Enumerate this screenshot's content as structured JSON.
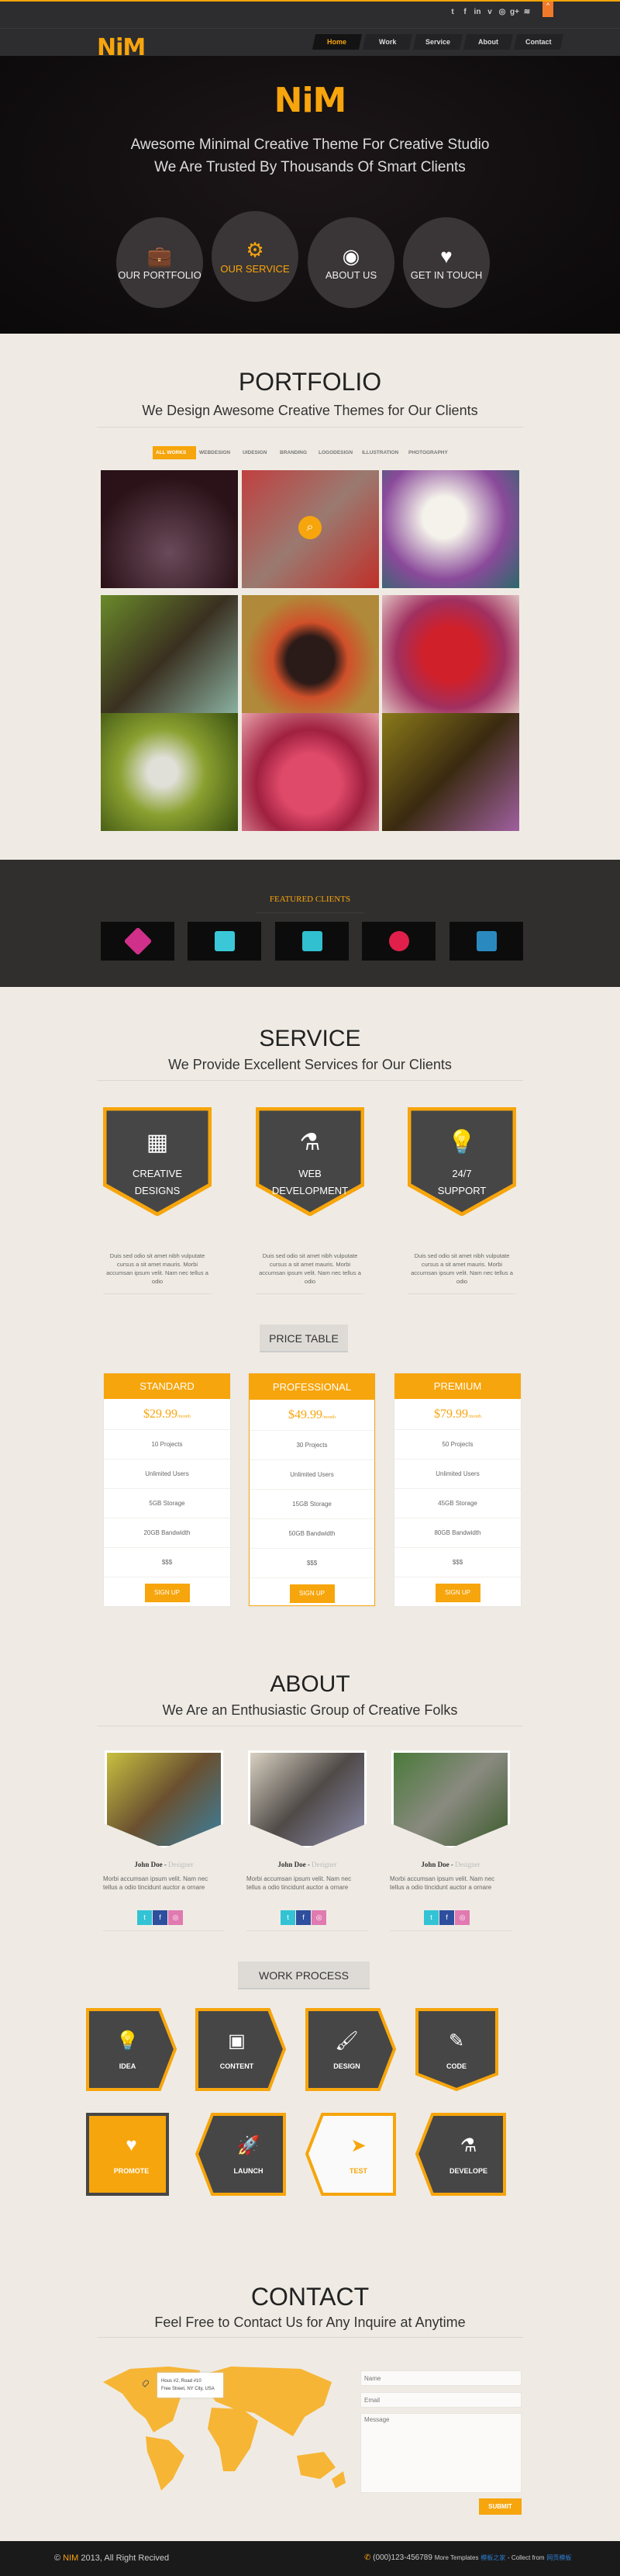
{
  "header": {
    "logo": "NiM",
    "social": [
      "twitter",
      "facebook",
      "linkedin",
      "vimeo",
      "dribbble",
      "google-plus",
      "rss"
    ],
    "social_glyphs": [
      "t",
      "f",
      "in",
      "v",
      "◎",
      "g+",
      "≋"
    ],
    "to_top": "^",
    "nav": [
      "Home",
      "Work",
      "Service",
      "About",
      "Contact"
    ],
    "active_nav": "Home"
  },
  "hero": {
    "logo": "NiM",
    "line1": "Awesome Minimal Creative Theme For Creative Studio",
    "line2": "We Are Trusted By Thousands Of Smart Clients",
    "buttons": [
      {
        "label": "OUR PORTFOLIO",
        "icon": "briefcase-icon",
        "glyph": "💼"
      },
      {
        "label": "OUR SERVICE",
        "icon": "gear-icon",
        "glyph": "⚙"
      },
      {
        "label": "ABOUT US",
        "icon": "eye-icon",
        "glyph": "◉"
      },
      {
        "label": "GET IN TOUCH",
        "icon": "heart-icon",
        "glyph": "♥"
      }
    ]
  },
  "portfolio": {
    "title": "PORTFOLIO",
    "subtitle": "We Design Awesome Creative Themes for Our Clients",
    "filters": [
      "ALL WORKS",
      "WEBDESIGN",
      "UIDESIGN",
      "BRANDING",
      "LOGODESIGN",
      "ILLUSTRATION",
      "PHOTOGRAPHY"
    ],
    "active_filter": "ALL WORKS",
    "items": [
      "sneakers",
      "merry-christmas",
      "orchid",
      "horse",
      "butterfly",
      "strawberries",
      "dandelion",
      "pink-shoes",
      "bicycle"
    ],
    "zoom_icon": "⌕"
  },
  "clients": {
    "title": "FEATURED CLIENTS",
    "logos": [
      "HB",
      "stripes",
      "bars",
      "V",
      "S"
    ]
  },
  "service": {
    "title": "SERVICE",
    "subtitle": "We Provide Excellent Services for Our Clients",
    "items": [
      {
        "line1": "CREATIVE",
        "line2": "DESIGNS",
        "icon": "presentation-icon"
      },
      {
        "line1": "WEB",
        "line2": "DEVELOPMENT",
        "icon": "flask-icon"
      },
      {
        "line1": "24/7",
        "line2": "SUPPORT",
        "icon": "lamp-icon"
      }
    ],
    "desc": "Duis sed odio sit amet nibh vulputate cursus a sit amet mauris. Morbi accumsan ipsum velit. Nam nec tellus a odio"
  },
  "pricing": {
    "button": "PRICE TABLE",
    "plans": [
      {
        "name": "STANDARD",
        "price": "$29.99",
        "per": "/month",
        "features": [
          "10 Projects",
          "Unlimited Users",
          "5GB Storage",
          "20GB Bandwidth",
          "$$$"
        ],
        "cta": "SIGN UP"
      },
      {
        "name": "PROFESSIONAL",
        "price": "$49.99",
        "per": "/month",
        "features": [
          "30 Projects",
          "Unlimited Users",
          "15GB Storage",
          "50GB Bandwidth",
          "$$$"
        ],
        "cta": "SIGN UP"
      },
      {
        "name": "PREMIUM",
        "price": "$79.99",
        "per": "/month",
        "features": [
          "50 Projects",
          "Unlimited Users",
          "45GB Storage",
          "80GB Bandwidth",
          "$$$"
        ],
        "cta": "SIGN UP"
      }
    ]
  },
  "about": {
    "title": "ABOUT",
    "subtitle": "We Are an Enthusiastic Group of Creative Folks",
    "members": [
      {
        "name": "John Doe",
        "role": "Designer",
        "bio": "Morbi accumsan ipsum velit. Nam nec tellus a odio tincidunt auctor a ornare"
      },
      {
        "name": "John Doe",
        "role": "Designer",
        "bio": "Morbi accumsan ipsum velit. Nam nec tellus a odio tincidunt auctor a ornare"
      },
      {
        "name": "John Doe",
        "role": "Designer",
        "bio": "Morbi accumsan ipsum velit. Nam nec tellus a odio tincidunt auctor a ornare"
      }
    ],
    "social_colors": [
      "#33c3d4",
      "#2d4f9e",
      "#e07ab0"
    ]
  },
  "process": {
    "button": "WORK PROCESS",
    "steps": [
      {
        "label": "IDEA",
        "glyph": "💡"
      },
      {
        "label": "CONTENT",
        "glyph": "▣"
      },
      {
        "label": "DESIGN",
        "glyph": "🖌"
      },
      {
        "label": "CODE",
        "glyph": "✎"
      },
      {
        "label": "PROMOTE",
        "glyph": "♥"
      },
      {
        "label": "LAUNCH",
        "glyph": "🚀"
      },
      {
        "label": "TEST",
        "glyph": "➤"
      },
      {
        "label": "DEVELOPE",
        "glyph": "⚗"
      }
    ]
  },
  "contact": {
    "title": "CONTACT",
    "subtitle": "Feel Free to Contact Us for Any Inquire at Anytime",
    "address1": "Hous #2, Road #10",
    "address2": "Free Street, NY City, USA",
    "name_placeholder": "Name",
    "email_placeholder": "Email",
    "message_placeholder": "Message",
    "submit": "SUBMIT"
  },
  "footer": {
    "copy_prefix": "©",
    "brand": "NIM",
    "copy_suffix": "2013, All Right Recived",
    "phone": "(000)123-456789",
    "more": "More Templates",
    "link1": "模板之家",
    "collect": "- Collect from",
    "link2": "网页模板"
  },
  "colors": {
    "accent": "#f7a50c",
    "dark": "#2d2c2e",
    "shield": "#464646",
    "bg": "#efebe4"
  }
}
